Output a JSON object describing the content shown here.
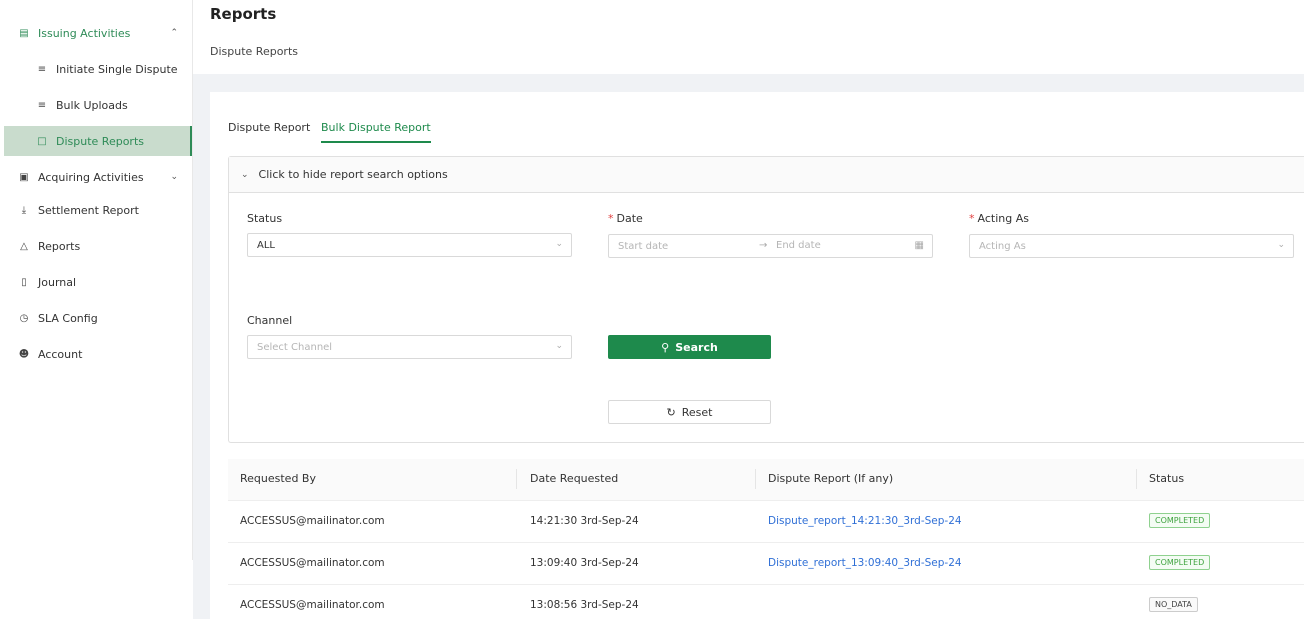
{
  "sidebar": {
    "items": [
      {
        "label": "Issuing Activities",
        "icon": "issuing-icon"
      },
      {
        "label": "Initiate Single Dispute",
        "icon": "list-icon"
      },
      {
        "label": "Bulk Uploads",
        "icon": "list-icon"
      },
      {
        "label": "Dispute Reports",
        "icon": "report-file-icon"
      },
      {
        "label": "Acquiring Activities",
        "icon": "acquiring-icon"
      },
      {
        "label": "Settlement Report",
        "icon": "download-icon"
      },
      {
        "label": "Reports",
        "icon": "warning-icon"
      },
      {
        "label": "Journal",
        "icon": "book-icon"
      },
      {
        "label": "SLA Config",
        "icon": "clock-icon"
      },
      {
        "label": "Account",
        "icon": "user-icon"
      }
    ]
  },
  "header": {
    "title": "Reports",
    "breadcrumb": "Dispute Reports"
  },
  "tabs": [
    {
      "label": "Dispute Report",
      "active": false
    },
    {
      "label": "Bulk Dispute Report",
      "active": true
    }
  ],
  "panel": {
    "toggle_label": "Click to hide report search options"
  },
  "form": {
    "status_label": "Status",
    "status_value": "ALL",
    "date_label": "Date",
    "date_start_placeholder": "Start date",
    "date_end_placeholder": "End date",
    "acting_label": "Acting As",
    "acting_placeholder": "Acting As",
    "channel_label": "Channel",
    "channel_placeholder": "Select Channel",
    "search_label": "Search",
    "reset_label": "Reset",
    "required_mark": "*"
  },
  "table": {
    "columns": [
      "Requested By",
      "Date Requested",
      "Dispute Report (If any)",
      "Status"
    ],
    "rows": [
      {
        "requested_by": "ACCESSUS@mailinator.com",
        "date": "14:21:30 3rd-Sep-24",
        "report": "Dispute_report_14:21:30_3rd-Sep-24",
        "status": "COMPLETED"
      },
      {
        "requested_by": "ACCESSUS@mailinator.com",
        "date": "13:09:40 3rd-Sep-24",
        "report": "Dispute_report_13:09:40_3rd-Sep-24",
        "status": "COMPLETED"
      },
      {
        "requested_by": "ACCESSUS@mailinator.com",
        "date": "13:08:56 3rd-Sep-24",
        "report": "",
        "status": "NO_DATA"
      }
    ]
  },
  "colors": {
    "accent": "#1e8a4c",
    "link": "#2f6fd6",
    "active_bg": "#c9dccd"
  }
}
